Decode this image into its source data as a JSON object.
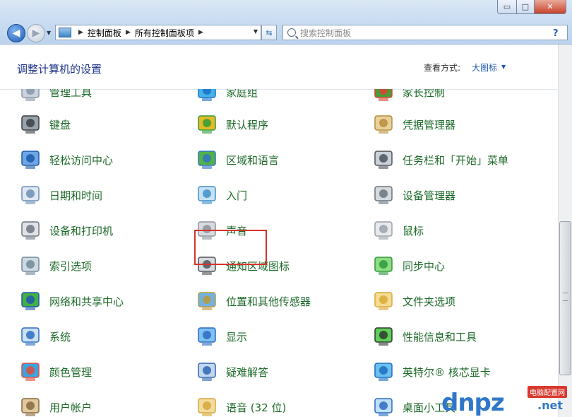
{
  "window": {
    "title_buttons": {
      "minimize": "▭",
      "maximize": "□",
      "close": "✕"
    }
  },
  "nav": {
    "breadcrumbs": [
      "控制面板",
      "所有控制面板项"
    ],
    "search_placeholder": "搜索控制面板",
    "help": "?"
  },
  "header": {
    "title": "调整计算机的设置",
    "view_by_label": "查看方式:",
    "view_by_value": "大图标"
  },
  "columns": [
    [
      {
        "label": "管理工具",
        "icon": "admin-tools-icon"
      },
      {
        "label": "键盘",
        "icon": "keyboard-icon"
      },
      {
        "label": "轻松访问中心",
        "icon": "ease-of-access-icon"
      },
      {
        "label": "日期和时间",
        "icon": "date-time-icon"
      },
      {
        "label": "设备和打印机",
        "icon": "printer-icon"
      },
      {
        "label": "索引选项",
        "icon": "indexing-icon"
      },
      {
        "label": "网络和共享中心",
        "icon": "network-icon"
      },
      {
        "label": "系统",
        "icon": "system-icon"
      },
      {
        "label": "颜色管理",
        "icon": "color-management-icon"
      },
      {
        "label": "用户帐户",
        "icon": "user-accounts-icon"
      }
    ],
    [
      {
        "label": "家庭组",
        "icon": "homegroup-icon"
      },
      {
        "label": "默认程序",
        "icon": "default-programs-icon"
      },
      {
        "label": "区域和语言",
        "icon": "region-language-icon"
      },
      {
        "label": "入门",
        "icon": "getting-started-icon"
      },
      {
        "label": "声音",
        "icon": "sound-icon"
      },
      {
        "label": "通知区域图标",
        "icon": "notification-area-icon"
      },
      {
        "label": "位置和其他传感器",
        "icon": "location-sensors-icon"
      },
      {
        "label": "显示",
        "icon": "display-icon"
      },
      {
        "label": "疑难解答",
        "icon": "troubleshooting-icon"
      },
      {
        "label": "语音 (32 位)",
        "icon": "speech-icon"
      }
    ],
    [
      {
        "label": "家长控制",
        "icon": "parental-controls-icon"
      },
      {
        "label": "凭据管理器",
        "icon": "credential-manager-icon"
      },
      {
        "label": "任务栏和「开始」菜单",
        "icon": "taskbar-icon"
      },
      {
        "label": "设备管理器",
        "icon": "device-manager-icon"
      },
      {
        "label": "鼠标",
        "icon": "mouse-icon"
      },
      {
        "label": "同步中心",
        "icon": "sync-center-icon"
      },
      {
        "label": "文件夹选项",
        "icon": "folder-options-icon"
      },
      {
        "label": "性能信息和工具",
        "icon": "performance-icon"
      },
      {
        "label": "英特尔® 核芯显卡",
        "icon": "intel-graphics-icon"
      },
      {
        "label": "桌面小工具",
        "icon": "gadgets-icon"
      }
    ]
  ],
  "watermark": {
    "logo": "dnpz",
    "tag": "电脑配置网",
    "domain": ".net"
  }
}
